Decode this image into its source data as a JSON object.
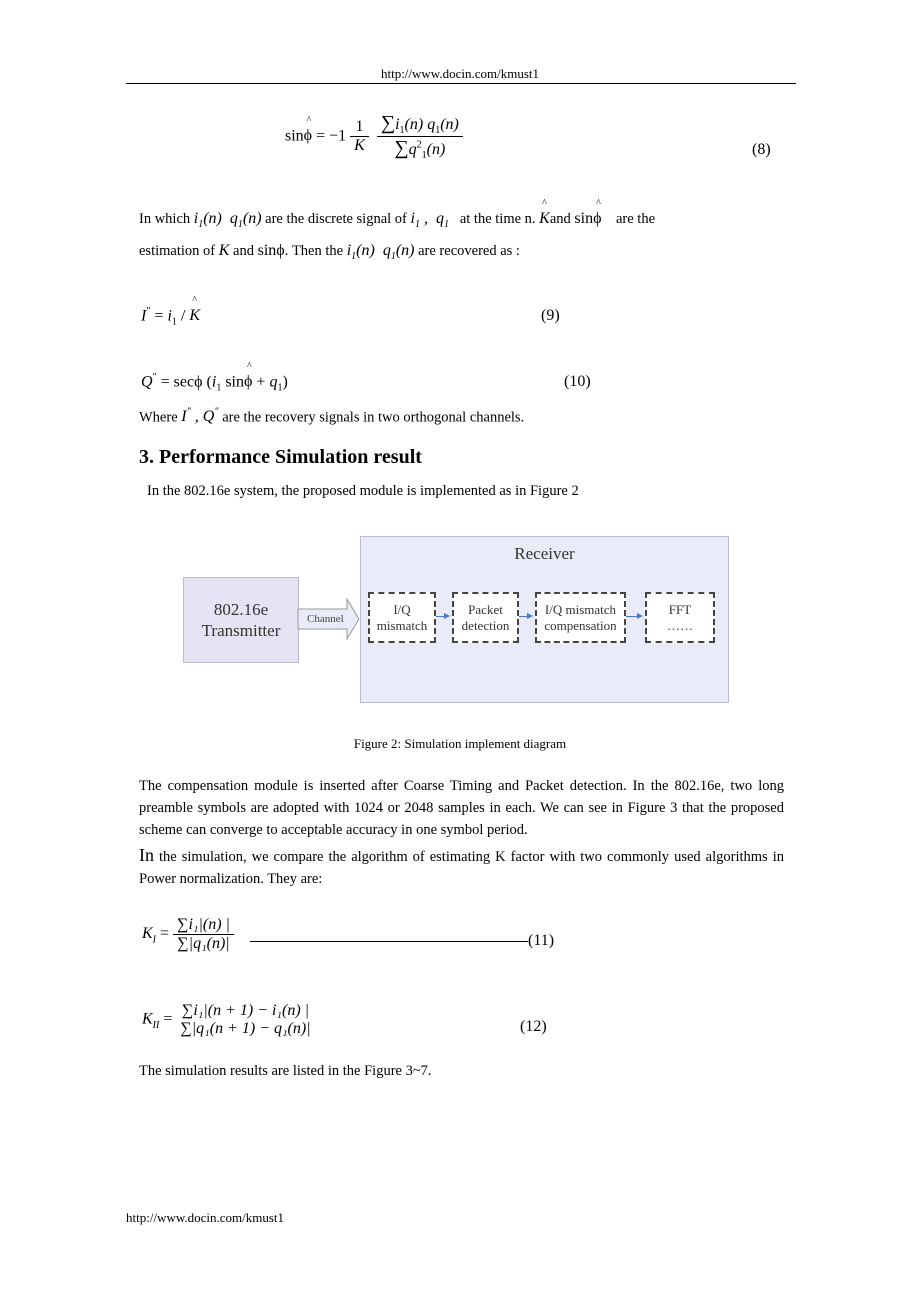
{
  "header": {
    "url": "http://www.docin.com/kmust1"
  },
  "footer": {
    "url": "http://www.docin.com/kmust1"
  },
  "eq8": {
    "lhs": "sin",
    "phi": "ϕ",
    "eq": "= −1",
    "one": "1",
    "K": "K",
    "sum": "∑",
    "i": "i",
    "q": "q",
    "sub1": "1",
    "n": "n",
    "paren_n": "(n)",
    "two": "2",
    "number": "(8)"
  },
  "para1": {
    "l1a": "In which ",
    "l1b": " are the discrete signal of ",
    "l1c": " at the time n. ",
    "l1d": "and ",
    "l1e": " are the",
    "l2a": "estimation of ",
    "l2b": " and ",
    "l2c": ". Then the ",
    "l2d": " are recovered as :"
  },
  "eq9": {
    "I": "I",
    "star": "\"",
    "eq": " = ",
    "i": "i",
    "sub1": "1",
    "slash": " / ",
    "K": "K",
    "number": "(9)"
  },
  "eq10": {
    "Q": "Q",
    "star": "\"",
    "eq": " = sec",
    "phi": "ϕ",
    "open": " (",
    "i": "i",
    "sub1": "1",
    "sin": " sin",
    "plus": " + ",
    "q": "q",
    "close": ")",
    "number": "(10)"
  },
  "where": {
    "a": "Where ",
    "b": " are the recovery signals in two orthogonal channels."
  },
  "section": {
    "title": "3. Performance Simulation result"
  },
  "intro": "In the 802.16e system, the proposed module is implemented as in Figure 2",
  "diagram": {
    "transmitter": [
      "802.16e",
      "Transmitter"
    ],
    "channel": "Channel",
    "receiver": "Receiver",
    "blocks": [
      [
        "I/Q",
        "mismatch"
      ],
      [
        "Packet",
        "detection"
      ],
      [
        "I/Q mismatch",
        "compensation"
      ],
      [
        "FFT",
        "……"
      ]
    ],
    "colors": {
      "box_fill": "#e9ecf8",
      "tx_fill": "#e4e4f4",
      "arrow": "#4a78c8"
    }
  },
  "caption": "Figure 2: Simulation implement diagram",
  "para2": "The compensation module is inserted after Coarse Timing and Packet detection. In the 802.16e, two long preamble symbols are adopted with 1024 or 2048 samples in each. We can see in Figure 3 that the proposed scheme can converge to acceptable accuracy in one symbol period.",
  "para3": {
    "first": "In",
    "rest": " the simulation, we compare the algorithm of estimating K factor with two commonly used algorithms in Power normalization. They are:"
  },
  "eq11": {
    "K": "K",
    "sub": "I",
    "eq": " = ",
    "num": "∑i₁|(n)  |",
    "den": "∑|q₁(n)|",
    "number": "(11)"
  },
  "eq12": {
    "K": "K",
    "sub": "II",
    "eq": " = ",
    "num": "∑i₁|(n + 1) − i₁(n)  |",
    "den": "∑|q₁(n + 1) − q₁(n)|",
    "number": "(12)"
  },
  "closing": "The simulation results are listed in the Figure 3~7."
}
